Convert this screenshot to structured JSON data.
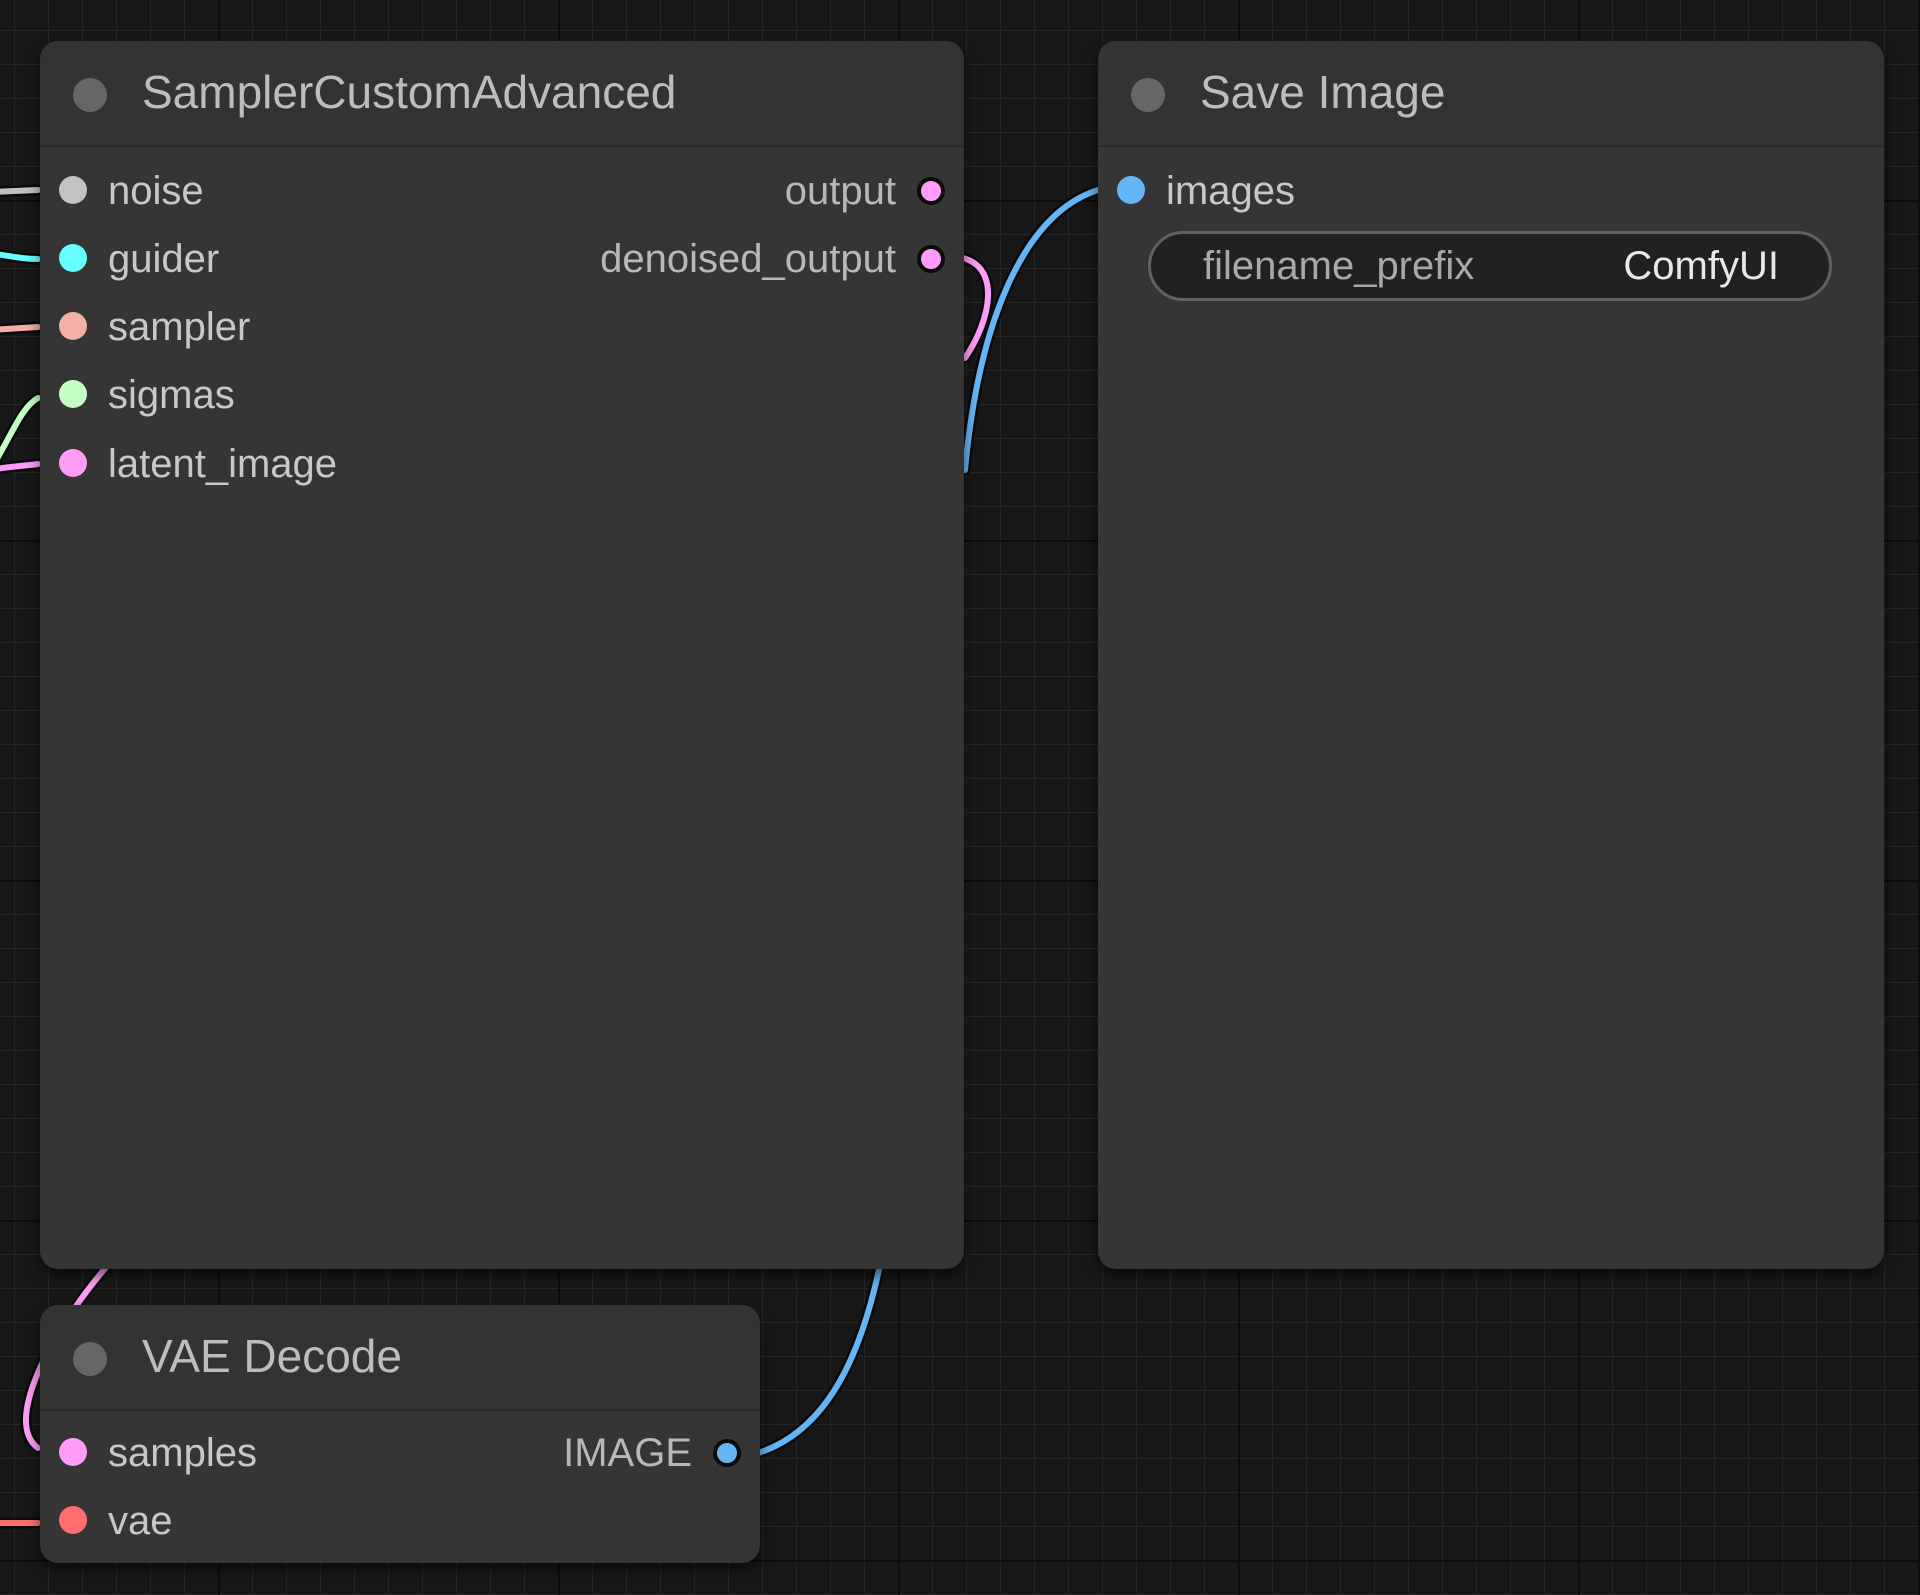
{
  "colors": {
    "noise": "#c2c2c2",
    "guider": "#66ffff",
    "sampler": "#f2b0a6",
    "sigmas": "#c6ffc6",
    "latent": "#ff9cf9",
    "image": "#64b5f6",
    "vae": "#ff6e6e",
    "node_bg": "#353535",
    "canvas_bg": "#171717"
  },
  "sampler_node": {
    "title": "SamplerCustomAdvanced",
    "inputs": [
      {
        "label": "noise",
        "type": "noise"
      },
      {
        "label": "guider",
        "type": "guider"
      },
      {
        "label": "sampler",
        "type": "sampler"
      },
      {
        "label": "sigmas",
        "type": "sigmas"
      },
      {
        "label": "latent_image",
        "type": "latent"
      }
    ],
    "outputs": [
      {
        "label": "output",
        "type": "latent"
      },
      {
        "label": "denoised_output",
        "type": "latent"
      }
    ]
  },
  "save_node": {
    "title": "Save Image",
    "inputs": [
      {
        "label": "images",
        "type": "image"
      }
    ],
    "widget": {
      "label": "filename_prefix",
      "value": "ComfyUI"
    }
  },
  "vae_node": {
    "title": "VAE Decode",
    "inputs": [
      {
        "label": "samples",
        "type": "latent"
      },
      {
        "label": "vae",
        "type": "vae"
      }
    ],
    "outputs": [
      {
        "label": "IMAGE",
        "type": "image"
      }
    ]
  }
}
